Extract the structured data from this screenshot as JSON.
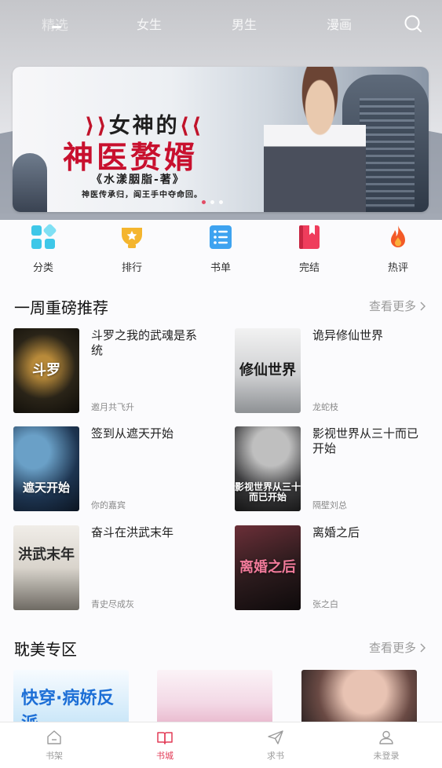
{
  "top_tabs": [
    "精选",
    "女生",
    "男生",
    "漫画"
  ],
  "banner": {
    "line1": "女神的",
    "line2": "神医赘婿",
    "line3": "《水漾胭脂-著》",
    "line4": "神医传承归，阎王手中夺命回。"
  },
  "categories": [
    {
      "label": "分类",
      "icon": "grid-icon",
      "color": "#3ec7e8"
    },
    {
      "label": "排行",
      "icon": "trophy-icon",
      "color": "#f4b52e"
    },
    {
      "label": "书单",
      "icon": "list-icon",
      "color": "#3ea3f0"
    },
    {
      "label": "完结",
      "icon": "bookmark-icon",
      "color": "#ef3d5c"
    },
    {
      "label": "热评",
      "icon": "fire-icon",
      "color": "#f35a27"
    }
  ],
  "sections": {
    "weekly": {
      "title": "一周重磅推荐",
      "more": "查看更多"
    },
    "danmei": {
      "title": "耽美专区",
      "more": "查看更多"
    }
  },
  "books": [
    {
      "title": "斗罗之我的武魂是系统",
      "author": "邀月共飞升",
      "cover_text": "斗罗",
      "cover_color": "#2a2418"
    },
    {
      "title": "诡异修仙世界",
      "author": "龙蛇枝",
      "cover_text": "修仙世界",
      "cover_color": "#cfd0d2"
    },
    {
      "title": "签到从遮天开始",
      "author": "你的嘉宾",
      "cover_text": "遮天开始",
      "cover_color": "#1d3450"
    },
    {
      "title": "影视世界从三十而已开始",
      "author": "隔壁刘总",
      "cover_text": "影视世界从三十而已开始",
      "cover_color": "#3b3b3d"
    },
    {
      "title": "奋斗在洪武末年",
      "author": "青史尽成灰",
      "cover_text": "洪武末年",
      "cover_color": "#d9d4cc"
    },
    {
      "title": "离婚之后",
      "author": "张之白",
      "cover_text": "离婚之后",
      "cover_color": "#2a1a1c"
    }
  ],
  "danmei_covers": [
    {
      "cover_text": "快穿·病娇反派",
      "cover_color": "#9fd3f2"
    },
    {
      "cover_text": "",
      "cover_color": "#f3d9e6"
    },
    {
      "cover_text": "",
      "cover_color": "#2f2524"
    }
  ],
  "bottom_nav": [
    {
      "label": "书架",
      "icon": "home-icon"
    },
    {
      "label": "书城",
      "icon": "book-icon",
      "active": true
    },
    {
      "label": "求书",
      "icon": "send-icon"
    },
    {
      "label": "未登录",
      "icon": "user-icon"
    }
  ],
  "colors": {
    "accent": "#e23b56",
    "muted": "#9b9b9b"
  }
}
